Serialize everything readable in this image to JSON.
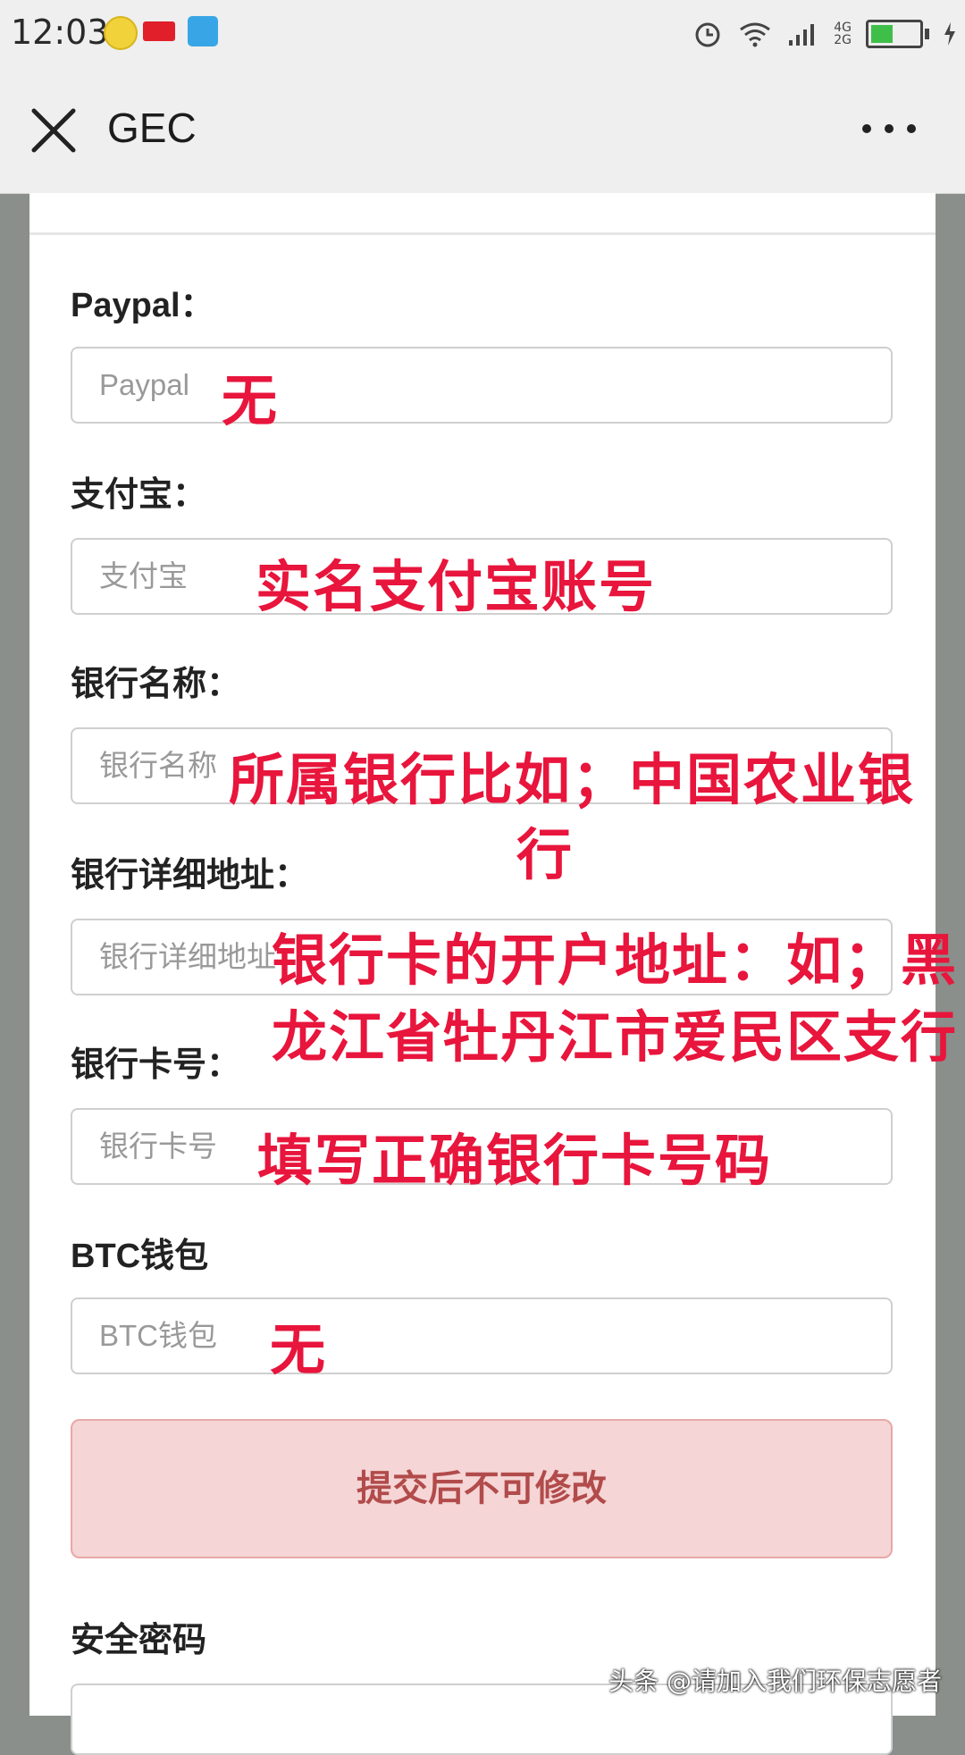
{
  "status_bar": {
    "time": "12:03",
    "network": "4G\n2G"
  },
  "header": {
    "title": "GEC",
    "close_icon": "close-icon",
    "more_icon": "more-icon"
  },
  "form": {
    "fields": [
      {
        "label": "Paypal：",
        "placeholder": "Paypal"
      },
      {
        "label": "支付宝：",
        "placeholder": "支付宝"
      },
      {
        "label": "银行名称：",
        "placeholder": "银行名称"
      },
      {
        "label": "银行详细地址：",
        "placeholder": "银行详细地址"
      },
      {
        "label": "银行卡号：",
        "placeholder": "银行卡号"
      },
      {
        "label": "BTC钱包",
        "placeholder": "BTC钱包"
      }
    ],
    "submit_label": "提交后不可修改",
    "security_label": "安全密码"
  },
  "annotations": [
    "无",
    "实名支付宝账号",
    "所属银行比如；中国农业银",
    "行",
    "银行卡的开户地址：如；黑",
    "龙江省牡丹江市爱民区支行",
    "填写正确银行卡号码",
    "无"
  ],
  "watermark": "头条 @请加入我们环保志愿者",
  "colors": {
    "annotation": "#e8153c",
    "submit_bg": "#f5d5d5",
    "submit_text": "#b24b4b"
  }
}
